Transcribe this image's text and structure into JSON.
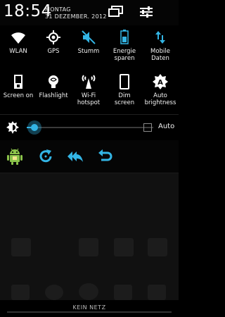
{
  "header": {
    "time": "18:54",
    "day": "MONTAG",
    "date": "31 DEZEMBER. 2012"
  },
  "tiles_row1": [
    {
      "label": "WLAN",
      "label2": "",
      "icon": "wifi-icon"
    },
    {
      "label": "GPS",
      "label2": "",
      "icon": "gps-icon"
    },
    {
      "label": "Stumm",
      "label2": "",
      "icon": "mute-icon"
    },
    {
      "label": "Energie",
      "label2": "sparen",
      "icon": "battery-saver-icon"
    },
    {
      "label": "Mobile",
      "label2": "Daten",
      "icon": "mobile-data-icon"
    }
  ],
  "tiles_row2": [
    {
      "label": "Screen on",
      "label2": "",
      "icon": "screen-on-icon"
    },
    {
      "label": "Flashlight",
      "label2": "",
      "icon": "flashlight-icon"
    },
    {
      "label": "Wi-Fi",
      "label2": "hotspot",
      "icon": "wifi-hotspot-icon"
    },
    {
      "label": "Dim",
      "label2": "screen",
      "icon": "dim-screen-icon"
    },
    {
      "label": "Auto",
      "label2": "brightness",
      "icon": "auto-brightness-icon"
    }
  ],
  "brightness": {
    "level": 0.06,
    "auto_label": "Auto",
    "auto_checked": false
  },
  "shortcuts": [
    "android-icon",
    "refresh-icon",
    "reply-all-icon",
    "undo-icon"
  ],
  "footer": {
    "status": "KEIN NETZ"
  },
  "colors": {
    "accent": "#33b5e5",
    "android_green": "#8bc34a"
  }
}
